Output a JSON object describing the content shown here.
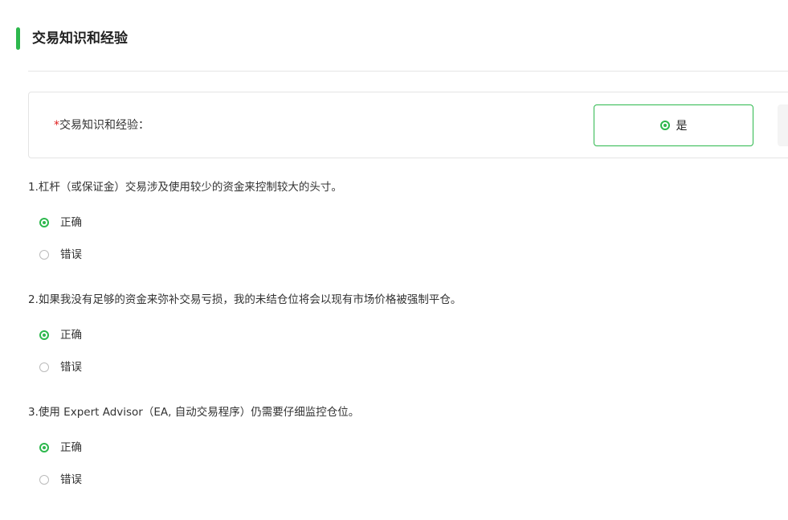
{
  "section": {
    "title": "交易知识和经验"
  },
  "summary": {
    "required_mark": "*",
    "label": "交易知识和经验：",
    "choices": [
      {
        "label": "是",
        "selected": true
      },
      {
        "label": "",
        "selected": false
      }
    ]
  },
  "questions": [
    {
      "text": "1.杠杆（或保证金）交易涉及使用较少的资金来控制较大的头寸。",
      "options": [
        {
          "label": "正确",
          "selected": true
        },
        {
          "label": "错误",
          "selected": false
        }
      ]
    },
    {
      "text": "2.如果我没有足够的资金来弥补交易亏损，我的未结仓位将会以现有市场价格被强制平仓。",
      "options": [
        {
          "label": "正确",
          "selected": true
        },
        {
          "label": "错误",
          "selected": false
        }
      ]
    },
    {
      "text": "3.使用 Expert Advisor（EA, 自动交易程序）仍需要仔细监控仓位。",
      "options": [
        {
          "label": "正确",
          "selected": true
        },
        {
          "label": "错误",
          "selected": false
        }
      ]
    }
  ],
  "colors": {
    "accent": "#2db84d",
    "required": "#e02020",
    "border": "#e4e4e4"
  }
}
